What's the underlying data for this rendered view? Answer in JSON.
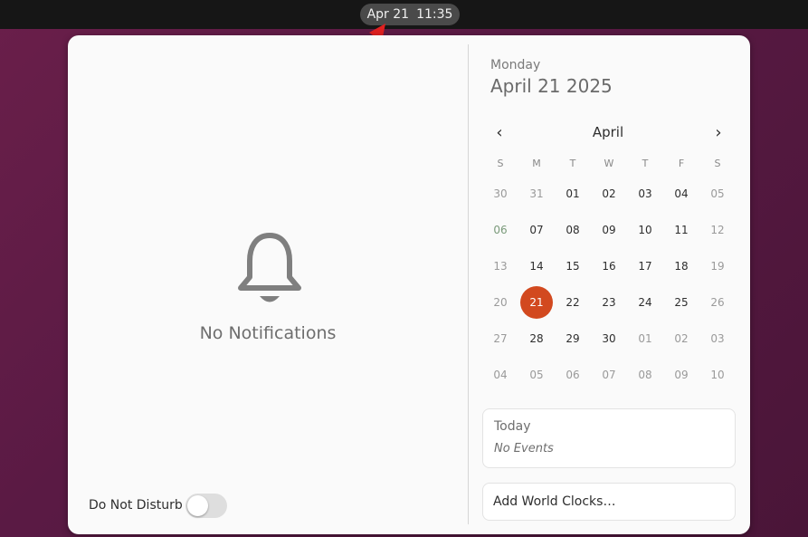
{
  "topbar": {
    "date": "Apr 21",
    "time": "11:35"
  },
  "notifications": {
    "empty_label": "No Notifications",
    "icon": "bell-icon"
  },
  "dnd": {
    "label": "Do Not Disturb",
    "enabled": false
  },
  "calendar": {
    "weekday": "Monday",
    "full_date": "April 21 2025",
    "month": "April",
    "prev_icon": "‹",
    "next_icon": "›",
    "day_headers": [
      "S",
      "M",
      "T",
      "W",
      "T",
      "F",
      "S"
    ],
    "weeks": [
      [
        "30",
        "31",
        "01",
        "02",
        "03",
        "04",
        "05"
      ],
      [
        "06",
        "07",
        "08",
        "09",
        "10",
        "11",
        "12"
      ],
      [
        "13",
        "14",
        "15",
        "16",
        "17",
        "18",
        "19"
      ],
      [
        "20",
        "21",
        "22",
        "23",
        "24",
        "25",
        "26"
      ],
      [
        "27",
        "28",
        "29",
        "30",
        "01",
        "02",
        "03"
      ],
      [
        "04",
        "05",
        "06",
        "07",
        "08",
        "09",
        "10"
      ]
    ],
    "selected_day": "21",
    "accent_color": "#d2491f"
  },
  "events": {
    "title": "Today",
    "empty_label": "No Events"
  },
  "world_clocks": {
    "label": "Add World Clocks…"
  }
}
